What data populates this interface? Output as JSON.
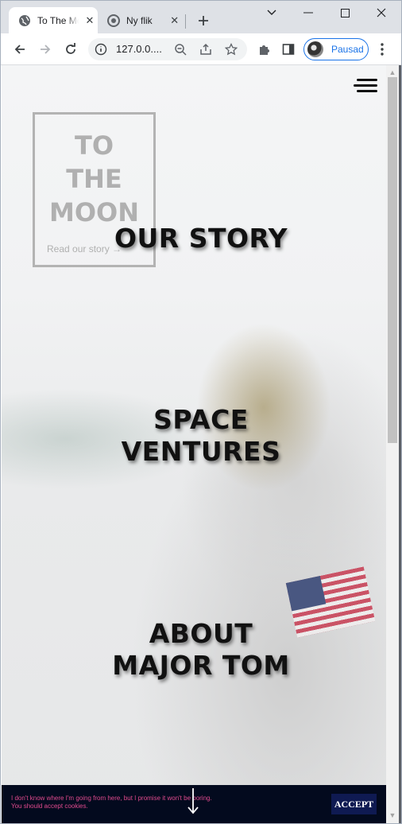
{
  "browser": {
    "tabs": [
      {
        "title": "To The Moon",
        "active": true
      },
      {
        "title": "Ny flik",
        "active": false
      }
    ],
    "address": "127.0.0....",
    "profile_name": "Pausad"
  },
  "page": {
    "logo_lines": [
      "TO",
      "THE",
      "MOON"
    ],
    "logo_link": "Read our story →",
    "headings": [
      {
        "lines": [
          "OUR STORY"
        ]
      },
      {
        "lines": [
          "SPACE",
          "VENTURES"
        ]
      },
      {
        "lines": [
          "ABOUT",
          "MAJOR TOM"
        ]
      }
    ]
  },
  "cookie_banner": {
    "line1": "I don't know where I'm going from here, but I promise it won't be boring.",
    "line2": "You should accept cookies.",
    "accept_label": "ACCEPT"
  },
  "colors": {
    "cookie_bg": "#030a1e",
    "cookie_text": "#e14a8e",
    "profile_accent": "#1a73e8"
  }
}
